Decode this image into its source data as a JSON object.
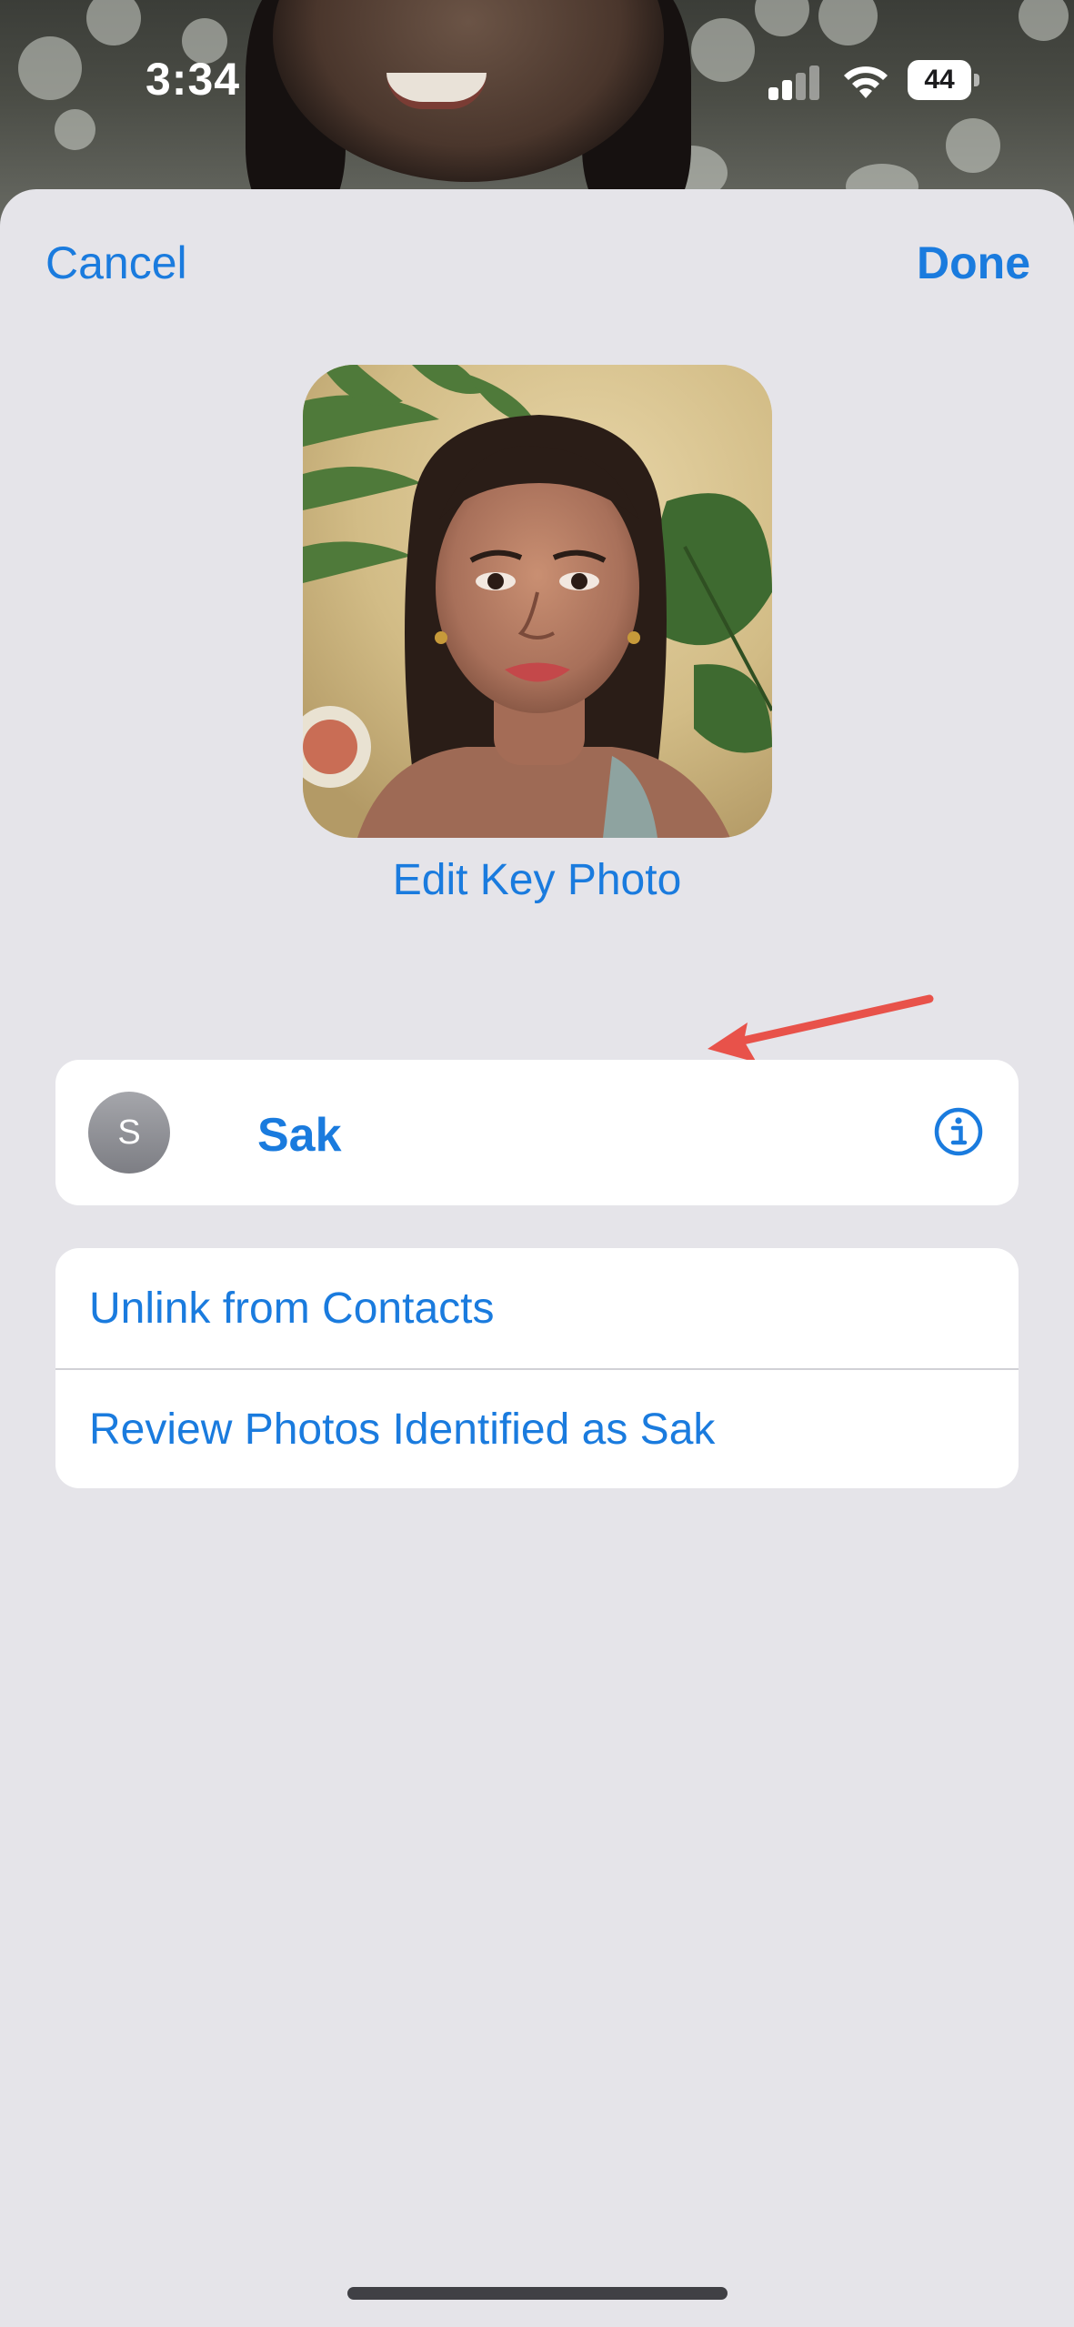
{
  "status_bar": {
    "time": "3:34",
    "battery_level": "44",
    "signal_icon": "cellular-signal-icon",
    "wifi_icon": "wifi-icon"
  },
  "nav": {
    "cancel_label": "Cancel",
    "done_label": "Done"
  },
  "key_photo": {
    "edit_label": "Edit Key Photo"
  },
  "contact": {
    "avatar_initial": "S",
    "name": "Sak",
    "info_icon": "info-icon"
  },
  "actions": [
    {
      "label": "Unlink from Contacts"
    },
    {
      "label": "Review Photos Identified as Sak"
    }
  ],
  "colors": {
    "accent": "#1a7bde",
    "sheet_background": "#e5e4e9",
    "card_background": "#ffffff",
    "annotation_arrow": "#e8524a"
  }
}
